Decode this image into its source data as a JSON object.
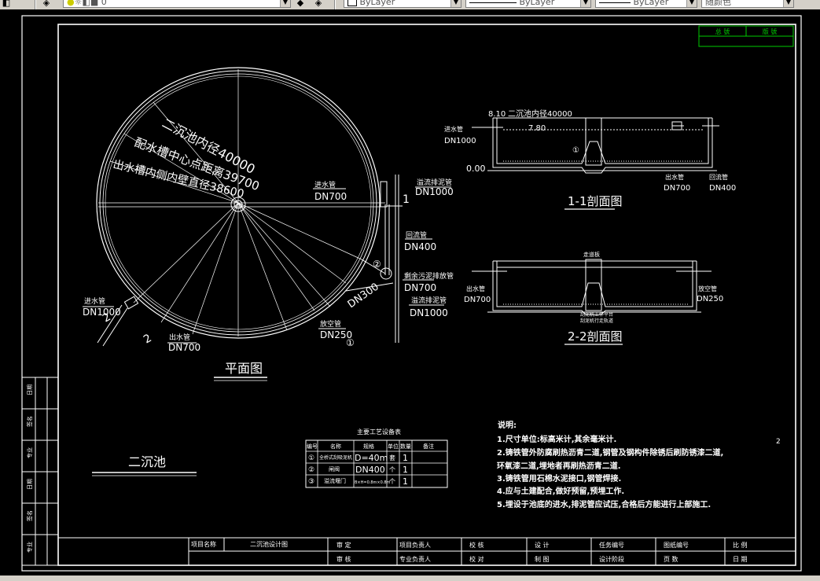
{
  "toolbar": {
    "layer_value": "0",
    "color_value": "ByLayer",
    "linetype_value": "ByLayer",
    "lineweight_value": "ByLayer",
    "plotstyle_value": "随颜色"
  },
  "title_block_top": {
    "c1": "总 號",
    "c2": "版 號"
  },
  "plan": {
    "title": "平面图",
    "dim1": "二沉池内径40000",
    "dim2": "配水槽中心点距离39700",
    "dim3": "出水槽内侧内壁直径38600",
    "lbl_pipe_in_top": "进水管",
    "lbl_dn700_top": "DN700",
    "lbl_overflow_top": "溢流排泥管",
    "lbl_dn1000_top": "DN1000",
    "lbl_return": "回流管",
    "lbl_dn400": "DN400",
    "lbl_sludge": "剩余污泥排放管",
    "lbl_dn700_mid": "DN700",
    "lbl_overflow_bot": "溢流排泥管",
    "lbl_dn1000_bot": "DN1000",
    "lbl_dn300": "DN300",
    "lbl_drain": "放空管",
    "lbl_dn250": "DN250",
    "lbl_inlet_left": "进水管",
    "lbl_dn1000_left": "DN1000",
    "lbl_outlet": "出水管",
    "lbl_dn700_bot": "DN700",
    "sec1": "1",
    "sec2": "2",
    "sec2b": "2",
    "circle1": "①",
    "circle2": "②"
  },
  "section11": {
    "title": "1-1剖面图",
    "elev_top": "8.10",
    "dim": "二沉池内径40000",
    "water": "7.80",
    "elev_bot": "0.00",
    "lbl_inlet": "进水管",
    "dn_inlet": "DN1000",
    "lbl_outlet": "出水管",
    "dn_outlet": "DN700",
    "lbl_return": "回流管",
    "dn_return": "DN400",
    "circle": "①"
  },
  "section22": {
    "title": "2-2剖面图",
    "lbl_inlet": "出水管",
    "dn_inlet": "DN700",
    "lbl_drain": "放空管",
    "dn_drain": "DN250",
    "note1": "刮泥机工作平台",
    "note2": "刮泥机行走轨道",
    "top_lbl": "走道板"
  },
  "equip_table": {
    "title": "主要工艺设备表",
    "headers": [
      "编号",
      "名称",
      "规格",
      "单位",
      "数量",
      "备注"
    ],
    "rows": [
      [
        "①",
        "全桥式刮吸泥机",
        "D=40m",
        "套",
        "1",
        ""
      ],
      [
        "②",
        "闸阀",
        "DN400",
        "个",
        "1",
        ""
      ],
      [
        "③",
        "溢流堰门",
        "B×H=0.8m×0.8m",
        "个",
        "1",
        ""
      ]
    ]
  },
  "drawing_name": "二沉池",
  "notes": {
    "heading": "说明:",
    "items": [
      "1.尺寸单位:标高米计,其余毫米计.",
      "2.铸铁管外防腐刷热沥青二道,钢管及钢构件除锈后刷防锈漆二道,",
      "  环氧漆二道,埋地者再刷热沥青二道.",
      "3.铸铁管用石棉水泥接口,钢管焊接.",
      "4.应与土建配合,做好预留,预埋工作.",
      "5.埋设于池底的进水,排泥管应试压,合格后方能进行上部施工."
    ]
  },
  "page_mark": "2",
  "left_strip": [
    "日期",
    "签名",
    "专业",
    "日期",
    "签名",
    "专业"
  ],
  "title_block": {
    "project_label": "项目名称",
    "project_value": "二沉池设计图",
    "cells": [
      "审 定",
      "项目负责人",
      "校 核",
      "设 计",
      "任务编号",
      "图纸编号",
      "比 例",
      "审 核",
      "专业负责人",
      "校 对",
      "制 图",
      "设计阶段",
      "页 数",
      "日 期"
    ]
  }
}
